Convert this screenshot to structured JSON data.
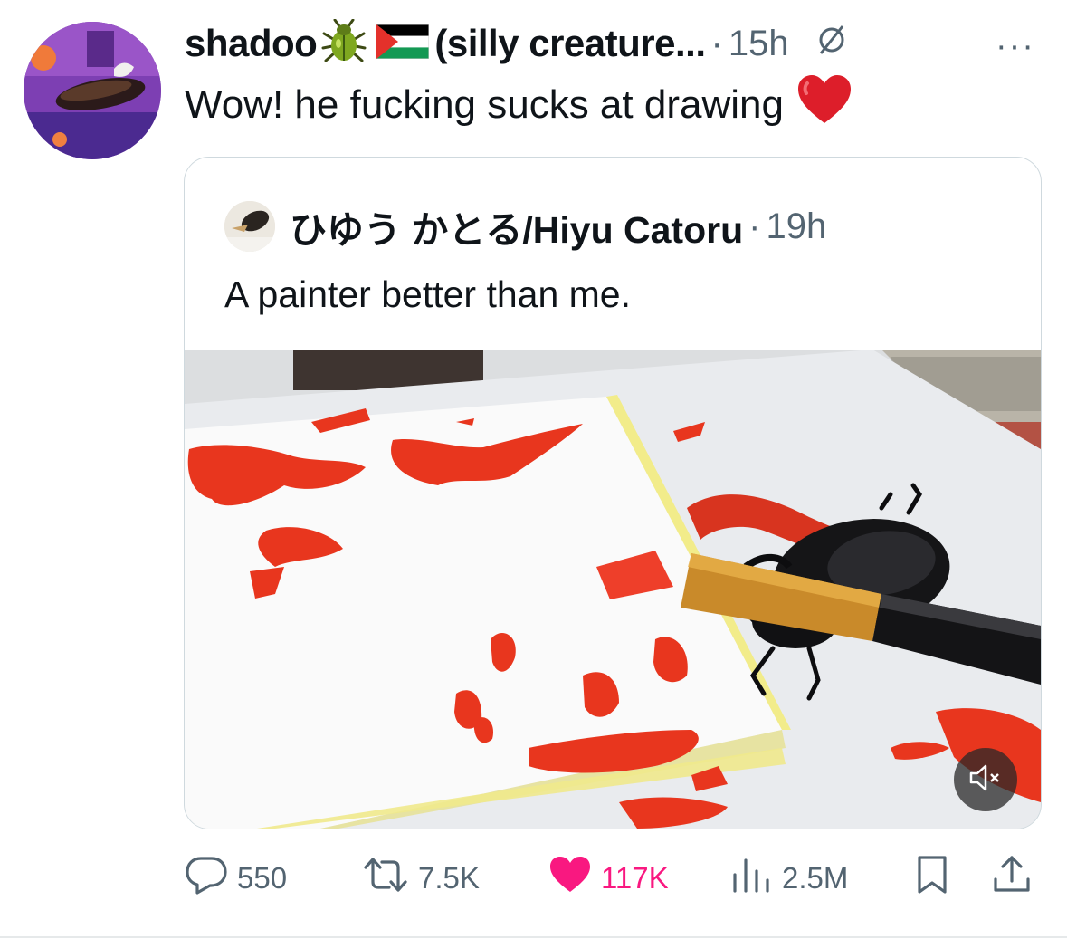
{
  "tweet": {
    "display_name": "shadoo",
    "name_suffix": "(silly creature...",
    "time": "15h",
    "separator": "·",
    "text": "Wow! he fucking sucks at drawing",
    "more_label": "···"
  },
  "quoted": {
    "display_name": "ひゆう かとる/Hiyu Catoru",
    "time": "19h",
    "separator": "·",
    "text": "A painter better than me."
  },
  "actions": {
    "replies": "550",
    "reposts": "7.5K",
    "likes": "117K",
    "views": "2.5M"
  },
  "colors": {
    "text": "#0f1419",
    "secondary": "#536471",
    "like": "#f91880",
    "border": "#cfd9de",
    "paint_red": "#e8361e"
  },
  "icons": {
    "beetle": "beetle-emoji-icon",
    "flag": "palestine-flag-icon",
    "heart_emoji": "red-heart-emoji-icon",
    "no_entry": "circle-slash-icon",
    "reply": "speech-bubble-icon",
    "repost": "repost-arrows-icon",
    "like": "heart-icon",
    "views": "bar-chart-icon",
    "bookmark": "bookmark-icon",
    "share": "share-upload-icon",
    "mute": "speaker-muted-icon"
  }
}
